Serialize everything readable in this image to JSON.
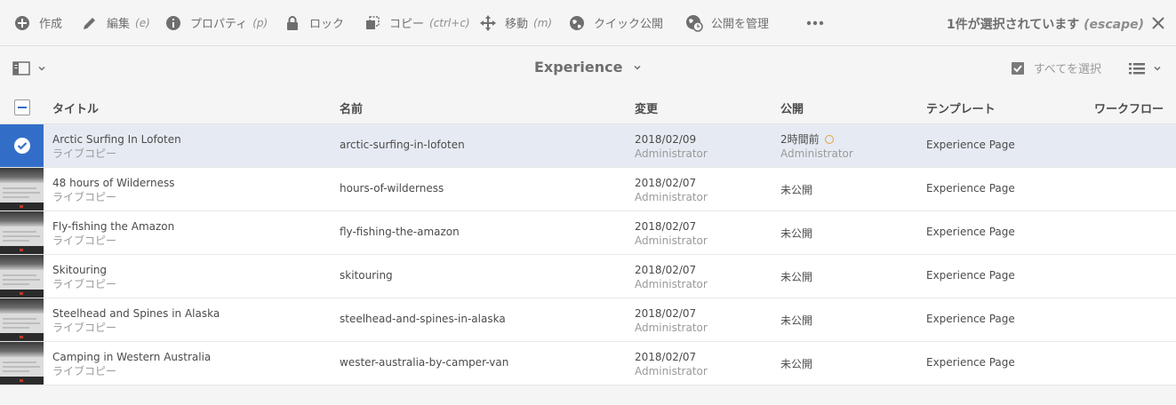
{
  "actions": [
    {
      "label": "作成",
      "hint": "",
      "icon": "add-icon"
    },
    {
      "label": "編集",
      "hint": "(e)",
      "icon": "edit-icon"
    },
    {
      "label": "プロパティ",
      "hint": "(p)",
      "icon": "info-icon"
    },
    {
      "label": "ロック",
      "hint": "",
      "icon": "lock-icon"
    },
    {
      "label": "コピー",
      "hint": "(ctrl+c)",
      "icon": "copy-icon"
    },
    {
      "label": "移動",
      "hint": "(m)",
      "icon": "move-icon"
    },
    {
      "label": "クイック公開",
      "hint": "",
      "icon": "globe-icon"
    },
    {
      "label": "公開を管理",
      "hint": "",
      "icon": "globe-clock-icon"
    }
  ],
  "more_icon": "more-icon",
  "selection": {
    "text": "1件が選択されています",
    "escape": "(escape)"
  },
  "titlebar": {
    "title": "Experience",
    "select_all": "すべてを選択"
  },
  "columns": {
    "title": "タイトル",
    "name": "名前",
    "modified": "変更",
    "published": "公開",
    "template": "テンプレート",
    "workflow": "ワークフロー"
  },
  "rows": [
    {
      "title": "Arctic Surfing In Lofoten",
      "subtitle": "ライブコピー",
      "name": "arctic-surfing-in-lofoten",
      "modified_date": "2018/02/09",
      "modified_by": "Administrator",
      "published": "2時間前",
      "published_by": "Administrator",
      "template": "Experience Page",
      "selected": true
    },
    {
      "title": "48 hours of Wilderness",
      "subtitle": "ライブコピー",
      "name": "hours-of-wilderness",
      "modified_date": "2018/02/07",
      "modified_by": "Administrator",
      "published": "未公開",
      "published_by": "",
      "template": "Experience Page",
      "selected": false
    },
    {
      "title": "Fly-fishing the Amazon",
      "subtitle": "ライブコピー",
      "name": "fly-fishing-the-amazon",
      "modified_date": "2018/02/07",
      "modified_by": "Administrator",
      "published": "未公開",
      "published_by": "",
      "template": "Experience Page",
      "selected": false
    },
    {
      "title": "Skitouring",
      "subtitle": "ライブコピー",
      "name": "skitouring",
      "modified_date": "2018/02/07",
      "modified_by": "Administrator",
      "published": "未公開",
      "published_by": "",
      "template": "Experience Page",
      "selected": false
    },
    {
      "title": "Steelhead and Spines in Alaska",
      "subtitle": "ライブコピー",
      "name": "steelhead-and-spines-in-alaska",
      "modified_date": "2018/02/07",
      "modified_by": "Administrator",
      "published": "未公開",
      "published_by": "",
      "template": "Experience Page",
      "selected": false
    },
    {
      "title": "Camping in Western Australia",
      "subtitle": "ライブコピー",
      "name": "wester-australia-by-camper-van",
      "modified_date": "2018/02/07",
      "modified_by": "Administrator",
      "published": "未公開",
      "published_by": "",
      "template": "Experience Page",
      "selected": false
    }
  ],
  "colors": {
    "accent": "#326ec8",
    "selected_row": "#e6ebf3",
    "clock": "#e6a23c"
  }
}
